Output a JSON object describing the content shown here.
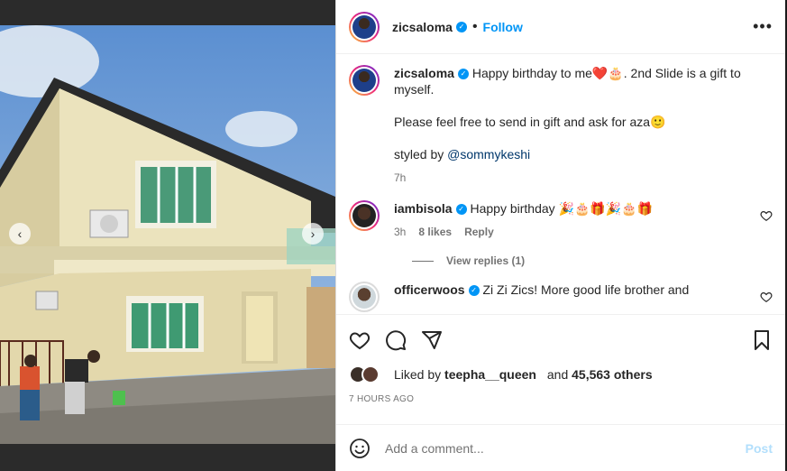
{
  "post": {
    "author": "zicsaloma",
    "follow_label": "Follow",
    "more_label": "•••",
    "caption": {
      "line1": "Happy birthday to me❤️🎂. 2nd Slide is a gift to myself.",
      "line2": "Please feel free to send in gift and ask for aza🙂",
      "line3_prefix": "styled by ",
      "line3_mention": "@sommykeshi",
      "time": "7h"
    },
    "comments": [
      {
        "user": "iambisola",
        "text": "Happy birthday 🎉🎂🎁🎉🎂🎁",
        "time": "3h",
        "likes": "8 likes",
        "reply_label": "Reply",
        "view_replies": "View replies (1)"
      },
      {
        "user": "officerwoos",
        "text": "Zi Zi Zics! More good life brother and"
      }
    ],
    "likes_text_prefix": "Liked by ",
    "likes_user": "teepha__queen",
    "likes_text_mid": " and ",
    "likes_count": "45,563 others",
    "time_ago": "7 HOURS AGO",
    "add_comment_placeholder": "Add a comment...",
    "post_label": "Post"
  },
  "carousel": {
    "prev": "‹",
    "next": "›",
    "slides": 2,
    "active_slide": 2
  },
  "colors": {
    "accent": "#0095f6",
    "post_disabled": "#b2dffc",
    "mention": "#00376b"
  }
}
